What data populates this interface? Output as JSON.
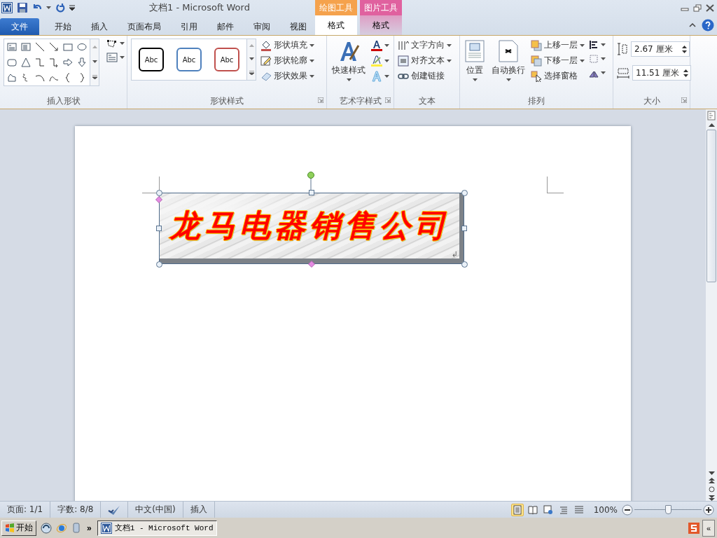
{
  "window": {
    "title": "文档1  -  Microsoft Word"
  },
  "context_groups": [
    {
      "title": "绘图工具",
      "color": "#f5a24c",
      "tab": {
        "label": "格式",
        "selected": true
      }
    },
    {
      "title": "图片工具",
      "color": "#e0619f",
      "tab": {
        "label": "格式",
        "selected": false
      }
    }
  ],
  "tabs": [
    {
      "label": "文件",
      "kind": "file",
      "selected": false
    },
    {
      "label": "开始",
      "kind": "normal",
      "selected": false
    },
    {
      "label": "插入",
      "kind": "normal",
      "selected": false
    },
    {
      "label": "页面布局",
      "kind": "normal",
      "selected": false
    },
    {
      "label": "引用",
      "kind": "normal",
      "selected": false
    },
    {
      "label": "邮件",
      "kind": "normal",
      "selected": false
    },
    {
      "label": "审阅",
      "kind": "normal",
      "selected": false
    },
    {
      "label": "视图",
      "kind": "normal",
      "selected": false
    }
  ],
  "ribbon": {
    "groups": [
      {
        "kind": "shapes",
        "label": "插入形状",
        "launcher": false
      },
      {
        "kind": "shape_styles",
        "label": "形状样式",
        "launcher": true,
        "styles": [
          {
            "label": "Abc",
            "color": "#000000"
          },
          {
            "label": "Abc",
            "color": "#4f81bd"
          },
          {
            "label": "Abc",
            "color": "#c0504d"
          }
        ],
        "commands": [
          "形状填充",
          "形状轮廓",
          "形状效果"
        ]
      },
      {
        "kind": "wordart",
        "label": "艺术字样式",
        "launcher": true,
        "button": "快速样式"
      },
      {
        "kind": "text",
        "label": "文本",
        "launcher": false,
        "commands": [
          "文字方向",
          "对齐文本",
          "创建链接"
        ]
      },
      {
        "kind": "arrange",
        "label": "排列",
        "launcher": false,
        "buttons": [
          "位置",
          "自动换行"
        ],
        "commands": [
          "上移一层",
          "下移一层",
          "选择窗格"
        ]
      },
      {
        "kind": "size",
        "label": "大小",
        "launcher": true,
        "fields": [
          {
            "value": "2.67 厘米"
          },
          {
            "value": "11.51 厘米"
          }
        ]
      }
    ]
  },
  "document": {
    "wordart": {
      "text": "龙马电器销售公司",
      "selected": true
    },
    "paragraph_mark": "↲"
  },
  "status_bar": {
    "items": [
      {
        "kind": "text",
        "label": "页面: 1/1"
      },
      {
        "kind": "text",
        "label": "字数: 8/8"
      },
      {
        "kind": "proofing"
      },
      {
        "kind": "text",
        "label": "中文(中国)"
      },
      {
        "kind": "text",
        "label": "插入"
      }
    ],
    "views": [
      {
        "selected": true
      },
      {
        "selected": false
      },
      {
        "selected": false
      },
      {
        "selected": false
      },
      {
        "selected": false
      }
    ],
    "zoom": {
      "label": "100%",
      "level": 0.5
    }
  },
  "taskbar": {
    "start": "开始",
    "overflow": "»",
    "tasks": [
      {
        "label": "文档1 - Microsoft Word",
        "selected": true
      }
    ],
    "tray_toggle": "«"
  }
}
